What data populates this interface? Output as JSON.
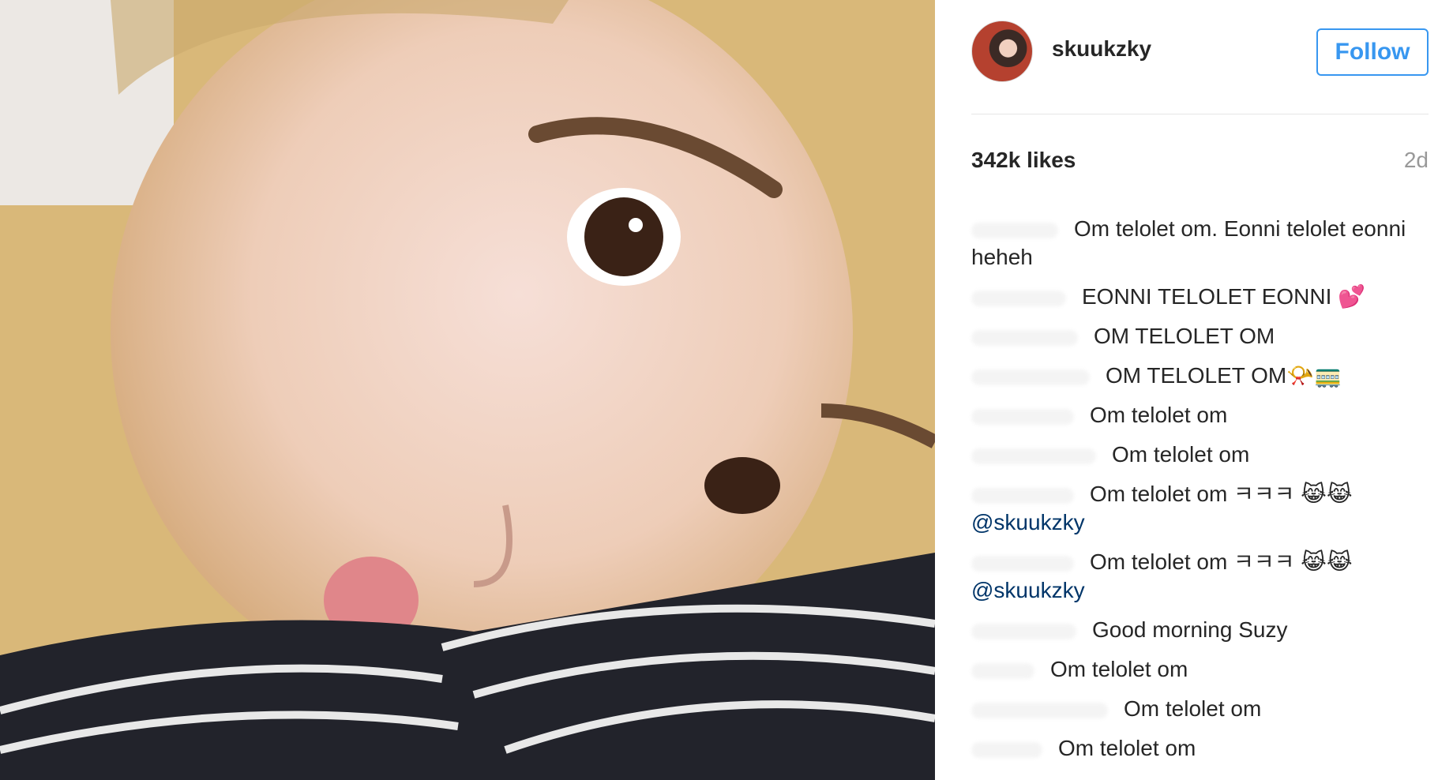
{
  "post": {
    "username": "skuukzky",
    "follow_label": "Follow",
    "likes": "342k likes",
    "time_ago": "2d"
  },
  "comments": [
    {
      "text": "Om telolet om. Eonni telolet eonni heheh"
    },
    {
      "text": "EONNI TELOLET EONNI 💕"
    },
    {
      "text": "OM TELOLET OM"
    },
    {
      "text": "OM TELOLET OM📯🚃"
    },
    {
      "text": "Om telolet om"
    },
    {
      "text": "Om telolet om"
    },
    {
      "text": "Om telolet om ㅋㅋㅋ 😹😹",
      "mention": "@skuukzky"
    },
    {
      "text": "Om telolet om ㅋㅋㅋ 😹😹",
      "mention": "@skuukzky"
    },
    {
      "text": "Good morning Suzy"
    },
    {
      "text": "Om telolet om"
    },
    {
      "text": "Om telolet om"
    },
    {
      "text": "Om telolet om"
    }
  ],
  "colors": {
    "accent": "#3897f0",
    "mention": "#003569",
    "text": "#262626",
    "muted": "#999999"
  }
}
